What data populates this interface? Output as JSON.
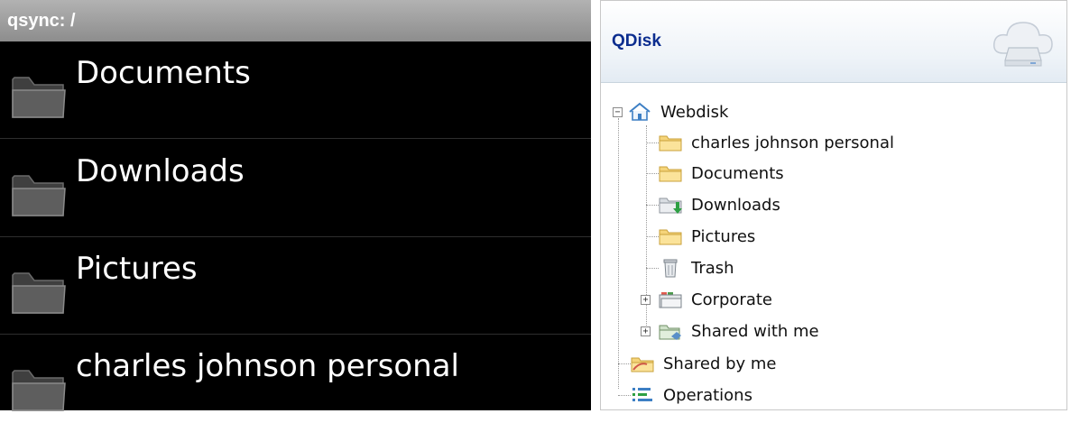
{
  "android": {
    "title": "qsync: /",
    "items": [
      {
        "label": "Documents",
        "icon": "folder-icon"
      },
      {
        "label": "Downloads",
        "icon": "folder-icon"
      },
      {
        "label": "Pictures",
        "icon": "folder-icon"
      },
      {
        "label": "charles johnson personal",
        "icon": "folder-icon"
      }
    ]
  },
  "qdisk": {
    "title": "QDisk",
    "header_icon": "cloud-disk-icon",
    "tree": {
      "root": {
        "label": "Webdisk",
        "icon": "home-icon",
        "toggle": "−"
      },
      "children": [
        {
          "label": "charles johnson personal",
          "icon": "folder-icon"
        },
        {
          "label": "Documents",
          "icon": "folder-icon"
        },
        {
          "label": "Downloads",
          "icon": "download-folder-icon"
        },
        {
          "label": "Pictures",
          "icon": "folder-icon"
        },
        {
          "label": "Trash",
          "icon": "trash-icon"
        },
        {
          "label": "Corporate",
          "icon": "group-folder-icon",
          "toggle": "+"
        },
        {
          "label": "Shared with me",
          "icon": "shared-with-me-icon",
          "toggle": "+"
        }
      ],
      "bottom": [
        {
          "label": "Shared by me",
          "icon": "shared-by-me-icon"
        },
        {
          "label": "Operations",
          "icon": "operations-list-icon"
        }
      ]
    }
  },
  "colors": {
    "android_bg": "#000000",
    "android_titlebar": "#9e9e9e",
    "qdisk_title": "#0b2d8f",
    "folder_yellow": "#f5d47a"
  }
}
